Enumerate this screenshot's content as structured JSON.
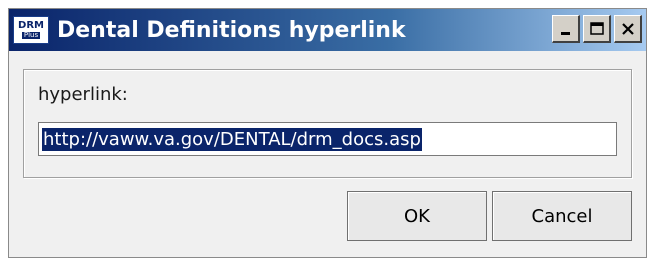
{
  "window": {
    "title": "Dental Definitions hyperlink",
    "app_icon": {
      "top": "DRM",
      "bottom": "Plus"
    }
  },
  "controls": {
    "minimize": "minimize",
    "maximize": "maximize",
    "close": "close"
  },
  "form": {
    "label": "hyperlink:",
    "value": "http://vaww.va.gov/DENTAL/drm_docs.asp"
  },
  "buttons": {
    "ok": "OK",
    "cancel": "Cancel"
  },
  "colors": {
    "title_start": "#0a246a",
    "title_end": "#a6caf0",
    "selection": "#0a246a"
  }
}
